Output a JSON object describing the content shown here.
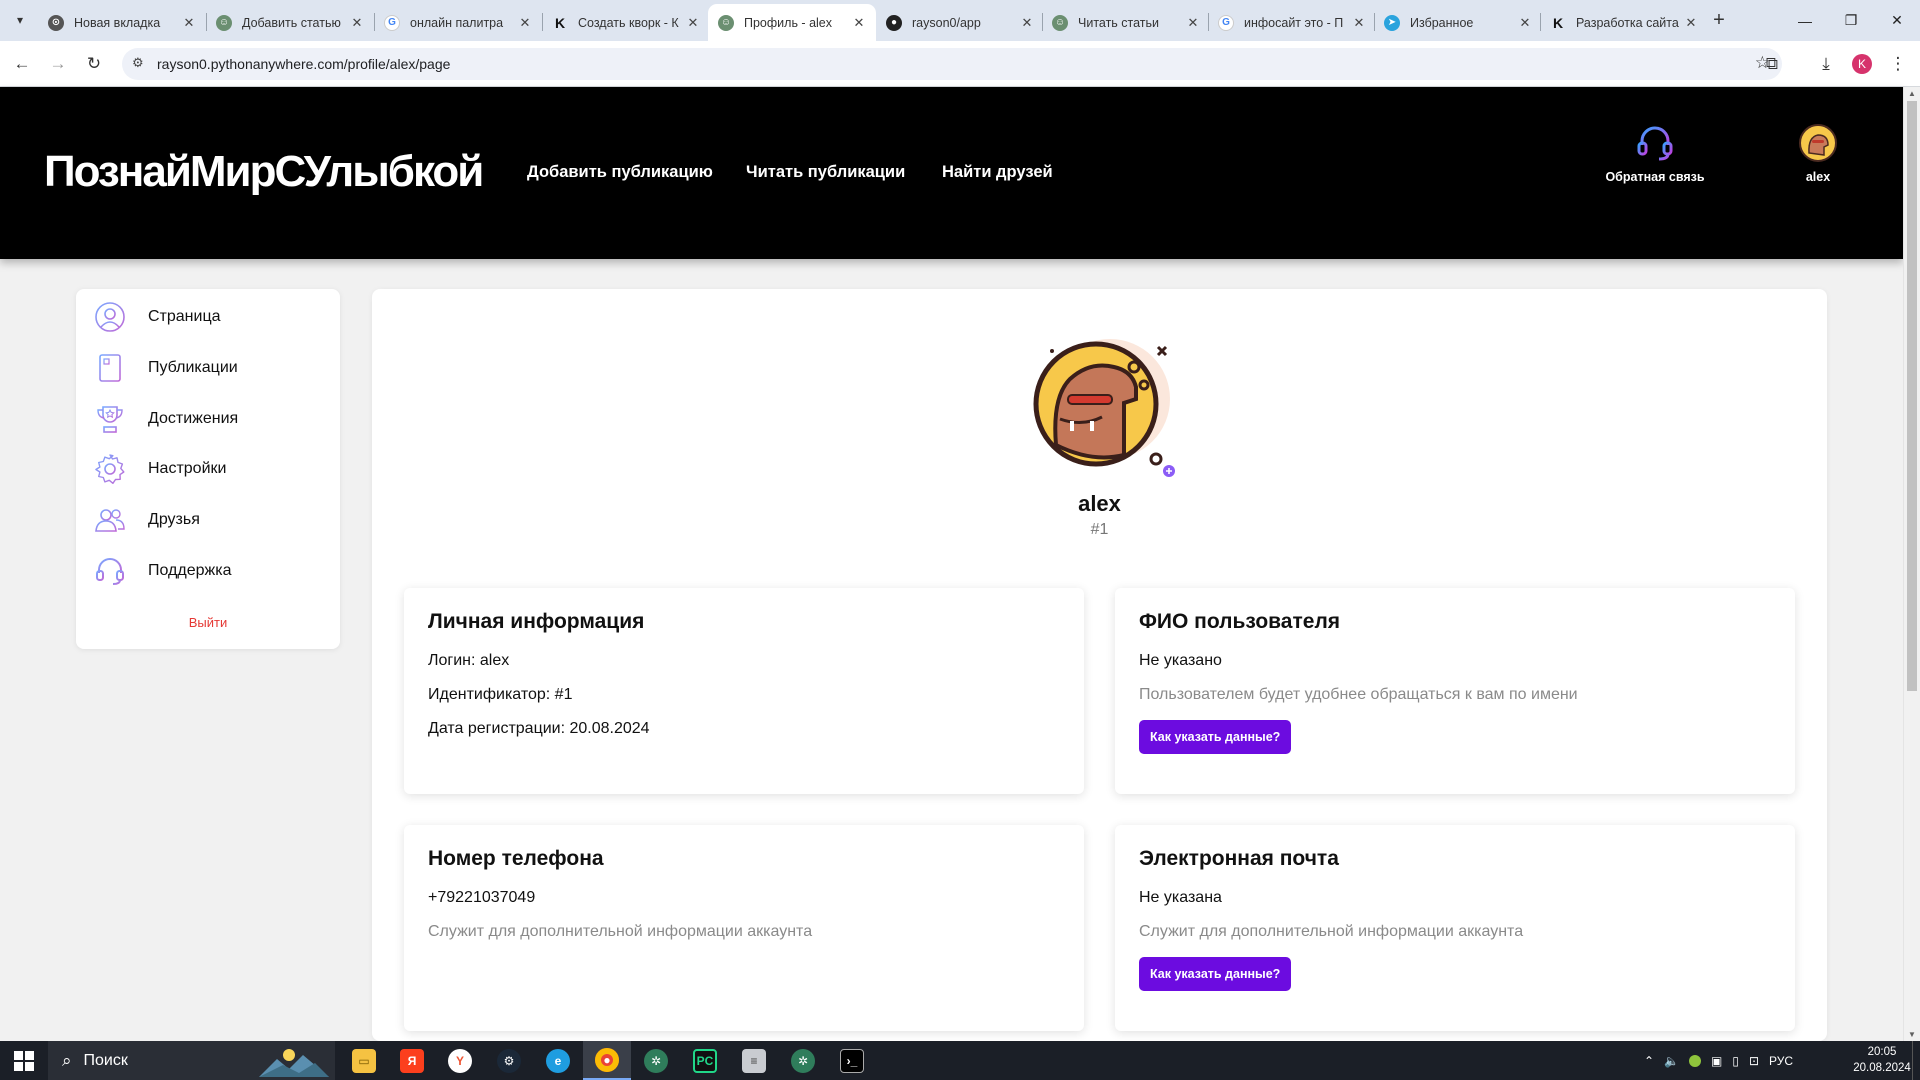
{
  "browser": {
    "tabs": [
      {
        "title": "Новая вкладка",
        "icon": "chrome-icon",
        "active": false
      },
      {
        "title": "Добавить статью",
        "icon": "site-icon",
        "active": false
      },
      {
        "title": "онлайн палитра",
        "icon": "google-icon",
        "active": false
      },
      {
        "title": "Создать кворк - К",
        "icon": "kwork-icon",
        "active": false
      },
      {
        "title": "Профиль - alex",
        "icon": "site-icon",
        "active": true
      },
      {
        "title": "rayson0/app",
        "icon": "github-icon",
        "active": false
      },
      {
        "title": "Читать статьи",
        "icon": "site-icon",
        "active": false
      },
      {
        "title": "инфосайт это - П",
        "icon": "google-icon",
        "active": false
      },
      {
        "title": "Избранное",
        "icon": "telegram-icon",
        "active": false
      },
      {
        "title": "Разработка сайта",
        "icon": "kwork-icon",
        "active": false
      }
    ],
    "url": "rayson0.pythonanywhere.com/profile/alex/page",
    "profile_initial": "K"
  },
  "site": {
    "logo": "ПознайМирСУлыбкой",
    "nav": [
      "Добавить публикацию",
      "Читать публикации",
      "Найти друзей"
    ],
    "feedback_label": "Обратная связь",
    "user_label": "alex"
  },
  "sidebar": {
    "items": [
      {
        "label": "Страница",
        "icon": "user-icon"
      },
      {
        "label": "Публикации",
        "icon": "publications-icon"
      },
      {
        "label": "Достижения",
        "icon": "trophy-icon"
      },
      {
        "label": "Настройки",
        "icon": "gear-icon"
      },
      {
        "label": "Друзья",
        "icon": "friends-icon"
      },
      {
        "label": "Поддержка",
        "icon": "headset-icon"
      }
    ],
    "logout": "Выйти"
  },
  "profile": {
    "name": "alex",
    "id": "#1"
  },
  "cards": {
    "personal": {
      "title": "Личная информация",
      "login": "Логин: alex",
      "identifier": "Идентификатор: #1",
      "registered": "Дата регистрации: 20.08.2024"
    },
    "fullname": {
      "title": "ФИО пользователя",
      "value": "Не указано",
      "hint": "Пользователем будет удобнее обращаться к вам по имени",
      "button": "Как указать данные?"
    },
    "phone": {
      "title": "Номер телефона",
      "value": "+79221037049",
      "hint": "Служит для дополнительной информации аккаунта"
    },
    "email": {
      "title": "Электронная почта",
      "value": "Не указана",
      "hint": "Служит для дополнительной информации аккаунта",
      "button": "Как указать данные?"
    }
  },
  "taskbar": {
    "search_placeholder": "Поиск",
    "language": "РУС",
    "time": "20:05",
    "date": "20.08.2024"
  },
  "colors": {
    "accent": "#6c0ce0",
    "logout": "#e53935",
    "header_bg": "#000000"
  }
}
